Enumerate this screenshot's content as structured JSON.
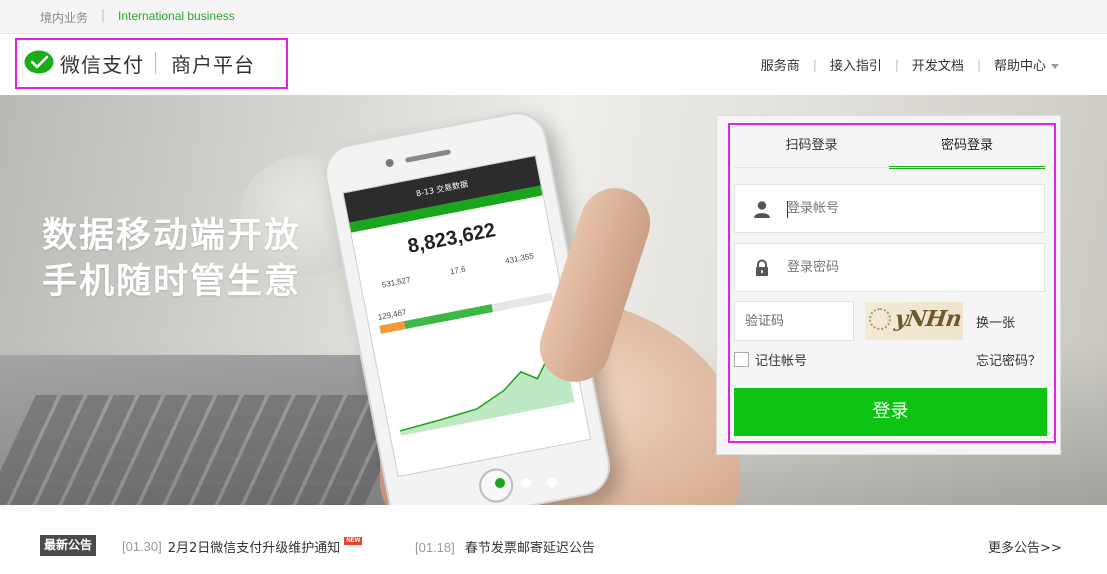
{
  "topbar": {
    "domestic": "境内业务",
    "divider": "|",
    "international": "International business"
  },
  "header": {
    "brand": "微信支付",
    "platform": "商户平台",
    "nav": [
      {
        "label": "服务商"
      },
      {
        "label": "接入指引"
      },
      {
        "label": "开发文档"
      },
      {
        "label": "帮助中心"
      }
    ],
    "nav_separator": "|"
  },
  "banner": {
    "slogan_line1": "数据移动端开放",
    "slogan_line2": "手机随时管生意",
    "phone": {
      "screen_title": "8-13 交易数据",
      "big_number": "8,823,622",
      "stats": [
        "531,527",
        "17.6",
        "431,355"
      ],
      "bar_value": "129,467"
    },
    "slides": 3,
    "active_slide": 1
  },
  "login": {
    "tabs": [
      {
        "label": "扫码登录",
        "active": false
      },
      {
        "label": "密码登录",
        "active": true
      }
    ],
    "username_placeholder": "登录帐号",
    "password_placeholder": "登录密码",
    "captcha_placeholder": "验证码",
    "captcha_text": "yNHn",
    "refresh_label": "换一张",
    "remember_label": "记住帐号",
    "forgot_label": "忘记密码？",
    "submit_label": "登录"
  },
  "notices": {
    "badge": "最新公告",
    "items": [
      {
        "date": "[01.30]",
        "title": "2月2日微信支付升级维护通知",
        "new_tag": "NEW"
      },
      {
        "date": "[01.18]",
        "title": "春节发票邮寄延迟公告"
      }
    ],
    "more_label": "更多公告>>"
  },
  "colors": {
    "brand_green": "#1aad19",
    "button_green": "#0dc413",
    "highlight_magenta": "#e023e0",
    "link_green": "#2ea32e"
  },
  "icons": [
    "wechat-pay-logo-icon",
    "user-icon",
    "lock-icon",
    "chevron-down-icon"
  ]
}
